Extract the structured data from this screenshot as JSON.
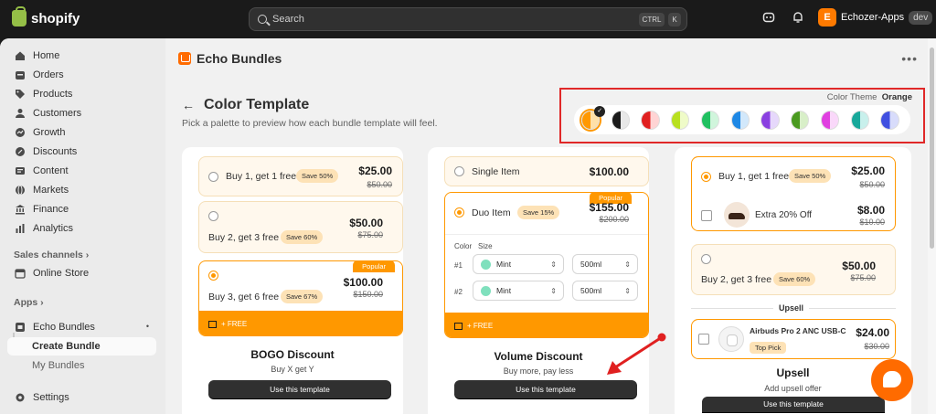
{
  "topbar": {
    "brand": "shopify",
    "search_placeholder": "Search",
    "kbd_ctrl": "CTRL",
    "kbd_k": "K",
    "store_initial": "E",
    "store_name": "Echozer-Apps",
    "store_env": "dev"
  },
  "sidebar": {
    "items": [
      {
        "label": "Home",
        "icon": "home-icon"
      },
      {
        "label": "Orders",
        "icon": "orders-icon"
      },
      {
        "label": "Products",
        "icon": "tag-icon"
      },
      {
        "label": "Customers",
        "icon": "person-icon"
      },
      {
        "label": "Growth",
        "icon": "growth-icon"
      },
      {
        "label": "Discounts",
        "icon": "discount-icon"
      },
      {
        "label": "Content",
        "icon": "content-icon"
      },
      {
        "label": "Markets",
        "icon": "globe-icon"
      },
      {
        "label": "Finance",
        "icon": "bank-icon"
      },
      {
        "label": "Analytics",
        "icon": "chart-icon"
      }
    ],
    "sales_channels_label": "Sales channels",
    "online_store": "Online Store",
    "apps_label": "Apps",
    "echo_bundles": "Echo Bundles",
    "create_bundle": "Create Bundle",
    "my_bundles": "My Bundles",
    "settings": "Settings"
  },
  "main": {
    "app_title": "Echo Bundles",
    "page_title": "Color Template",
    "subtitle": "Pick a palette to preview how each bundle template will feel.",
    "theme_label": "Color Theme",
    "theme_value": "Orange",
    "swatches": [
      {
        "name": "orange",
        "left": "#ff9800",
        "right": "#ffe0a8"
      },
      {
        "name": "black",
        "left": "#1a1a1a",
        "right": "#e8e8e8"
      },
      {
        "name": "red",
        "left": "#e02020",
        "right": "#ffd4d4"
      },
      {
        "name": "lime",
        "left": "#b8e020",
        "right": "#effbc8"
      },
      {
        "name": "green",
        "left": "#20c060",
        "right": "#d0f5dc"
      },
      {
        "name": "blue",
        "left": "#1e88e5",
        "right": "#d2e8fb"
      },
      {
        "name": "purple",
        "left": "#8a40e0",
        "right": "#e6d8fb"
      },
      {
        "name": "olive",
        "left": "#4a9a20",
        "right": "#d8efc8"
      },
      {
        "name": "pink",
        "left": "#e040e0",
        "right": "#fad8fa"
      },
      {
        "name": "teal",
        "left": "#18a89a",
        "right": "#c8f0ec"
      },
      {
        "name": "indigo",
        "left": "#4050e0",
        "right": "#d8dcfb"
      }
    ]
  },
  "bogo": {
    "opt1_title": "Buy 1, get 1 free",
    "opt1_save": "Save 50%",
    "opt1_price": "$25.00",
    "opt1_old": "$50.00",
    "opt2_title": "Buy 2, get 3 free",
    "opt2_save": "Save 60%",
    "opt2_price": "$50.00",
    "opt2_old": "$75.00",
    "opt3_title": "Buy 3, get 6 free",
    "opt3_save": "Save 67%",
    "opt3_price": "$100.00",
    "opt3_old": "$150.00",
    "popular": "Popular",
    "free": "+ FREE",
    "name": "BOGO Discount",
    "desc": "Buy X get Y",
    "button": "Use this template"
  },
  "volume": {
    "opt1_title": "Single Item",
    "opt1_price": "$100.00",
    "opt2_title": "Duo Item",
    "opt2_save": "Save 15%",
    "opt2_price": "$155.00",
    "opt2_old": "$200.00",
    "popular": "Popular",
    "color_label": "Color",
    "size_label": "Size",
    "row1_num": "#1",
    "row2_num": "#2",
    "color_value": "Mint",
    "size_value": "500ml",
    "free": "+ FREE",
    "name": "Volume Discount",
    "desc": "Buy more, pay less",
    "button": "Use this template"
  },
  "upsell": {
    "opt1_title": "Buy 1, get 1 free",
    "opt1_save": "Save 50%",
    "opt1_price": "$25.00",
    "opt1_old": "$50.00",
    "addon_title": "Extra 20% Off",
    "addon_price": "$8.00",
    "addon_old": "$10.00",
    "opt2_title": "Buy 2, get 3 free",
    "opt2_save": "Save 60%",
    "opt2_price": "$50.00",
    "opt2_old": "$75.00",
    "divider": "Upsell",
    "product_title": "Airbuds Pro 2 ANC USB-C",
    "product_badge": "Top Pick",
    "product_price": "$24.00",
    "product_old": "$30.00",
    "name": "Upsell",
    "desc": "Add upsell offer",
    "button": "Use this template"
  }
}
